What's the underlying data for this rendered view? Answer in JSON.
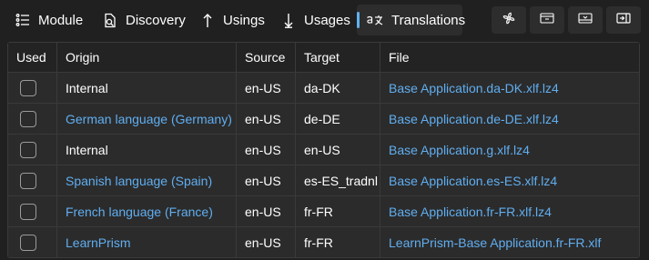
{
  "toolbar": {
    "tabs": [
      {
        "label": "Module",
        "icon": "list-icon"
      },
      {
        "label": "Discovery",
        "icon": "discovery-icon"
      },
      {
        "label": "Usings",
        "icon": "arrow-up-icon"
      },
      {
        "label": "Usages",
        "icon": "arrow-down-icon"
      },
      {
        "label": "Translations",
        "icon": "translate-icon",
        "active": true
      }
    ],
    "buttons": [
      {
        "icon": "fan-icon"
      },
      {
        "icon": "panel-top-icon"
      },
      {
        "icon": "panel-bottom-icon"
      },
      {
        "icon": "panel-exit-icon"
      }
    ]
  },
  "grid": {
    "columns": [
      "Used",
      "Origin",
      "Source",
      "Target",
      "File"
    ],
    "rows": [
      {
        "used": false,
        "origin": "Internal",
        "origin_link": false,
        "source": "en-US",
        "target": "da-DK",
        "file": "Base Application.da-DK.xlf.lz4"
      },
      {
        "used": false,
        "origin": "German language (Germany)",
        "origin_link": true,
        "source": "en-US",
        "target": "de-DE",
        "file": "Base Application.de-DE.xlf.lz4"
      },
      {
        "used": false,
        "origin": "Internal",
        "origin_link": false,
        "source": "en-US",
        "target": "en-US",
        "file": "Base Application.g.xlf.lz4"
      },
      {
        "used": false,
        "origin": "Spanish language (Spain)",
        "origin_link": true,
        "source": "en-US",
        "target": "es-ES_tradnl",
        "file": "Base Application.es-ES.xlf.lz4"
      },
      {
        "used": false,
        "origin": "French language (France)",
        "origin_link": true,
        "source": "en-US",
        "target": "fr-FR",
        "file": "Base Application.fr-FR.xlf.lz4"
      },
      {
        "used": false,
        "origin": "LearnPrism",
        "origin_link": true,
        "source": "en-US",
        "target": "fr-FR",
        "file": "LearnPrism-Base Application.fr-FR.xlf"
      }
    ]
  },
  "colors": {
    "background": "#202020",
    "link": "#60aef0",
    "accent": "#5fb2f2"
  }
}
